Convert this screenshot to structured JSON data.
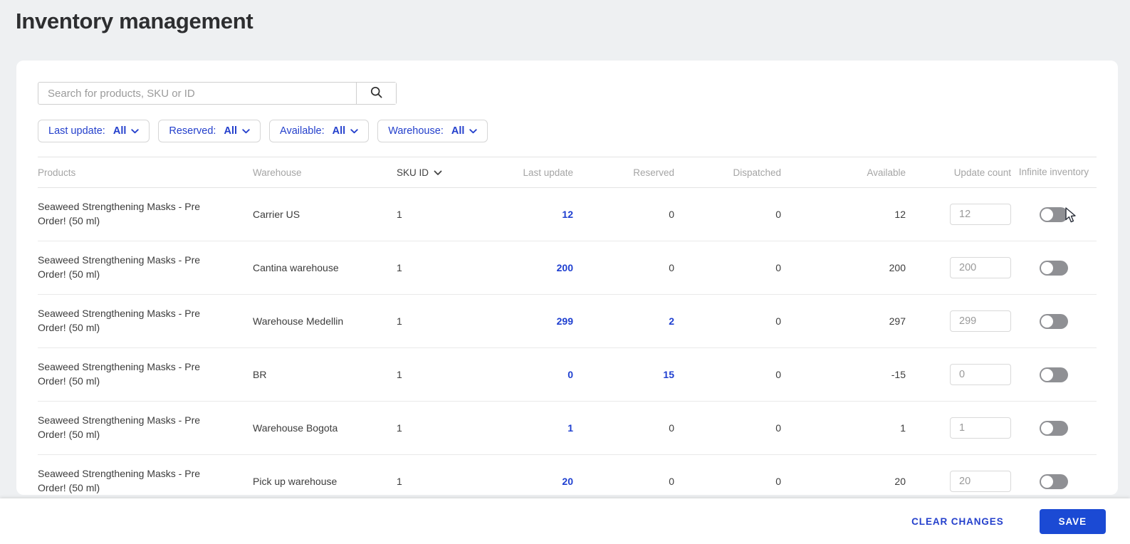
{
  "page": {
    "title": "Inventory management"
  },
  "search": {
    "placeholder": "Search for products, SKU or ID",
    "value": ""
  },
  "filters": [
    {
      "name": "last-update",
      "label": "Last update:",
      "value": "All"
    },
    {
      "name": "reserved",
      "label": "Reserved:",
      "value": "All"
    },
    {
      "name": "available",
      "label": "Available:",
      "value": "All"
    },
    {
      "name": "warehouse",
      "label": "Warehouse:",
      "value": "All"
    }
  ],
  "table": {
    "columns": [
      "Products",
      "Warehouse",
      "SKU ID",
      "Last update",
      "Reserved",
      "Dispatched",
      "Available",
      "Update count",
      "Infinite inventory"
    ],
    "sort": {
      "column": "SKU ID",
      "direction": "down"
    },
    "rows": [
      {
        "product": "Seaweed Strengthening Masks - Pre Order! (50 ml)",
        "warehouse": "Carrier US",
        "sku_id": "1",
        "last_update": "12",
        "reserved": "0",
        "dispatched": "0",
        "available": "12",
        "update_count": "12",
        "infinite_inventory": false
      },
      {
        "product": "Seaweed Strengthening Masks - Pre Order! (50 ml)",
        "warehouse": "Cantina warehouse",
        "sku_id": "1",
        "last_update": "200",
        "reserved": "0",
        "dispatched": "0",
        "available": "200",
        "update_count": "200",
        "infinite_inventory": false
      },
      {
        "product": "Seaweed Strengthening Masks - Pre Order! (50 ml)",
        "warehouse": "Warehouse Medellin",
        "sku_id": "1",
        "last_update": "299",
        "reserved": "2",
        "dispatched": "0",
        "available": "297",
        "update_count": "299",
        "infinite_inventory": false
      },
      {
        "product": "Seaweed Strengthening Masks - Pre Order! (50 ml)",
        "warehouse": "BR",
        "sku_id": "1",
        "last_update": "0",
        "reserved": "15",
        "dispatched": "0",
        "available": "-15",
        "update_count": "0",
        "infinite_inventory": false
      },
      {
        "product": "Seaweed Strengthening Masks - Pre Order! (50 ml)",
        "warehouse": "Warehouse Bogota",
        "sku_id": "1",
        "last_update": "1",
        "reserved": "0",
        "dispatched": "0",
        "available": "1",
        "update_count": "1",
        "infinite_inventory": false
      },
      {
        "product": "Seaweed Strengthening Masks - Pre Order! (50 ml)",
        "warehouse": "Pick up warehouse",
        "sku_id": "1",
        "last_update": "20",
        "reserved": "0",
        "dispatched": "0",
        "available": "20",
        "update_count": "20",
        "infinite_inventory": false
      }
    ]
  },
  "footer": {
    "clear_changes_label": "CLEAR CHANGES",
    "save_label": "SAVE"
  },
  "colors": {
    "accent_blue": "#2440cc",
    "value_blue": "#1e3fd0",
    "save_button_blue": "#1b4ad4",
    "toggle_off_gray": "#8f9094",
    "page_background": "#eef0f2"
  }
}
